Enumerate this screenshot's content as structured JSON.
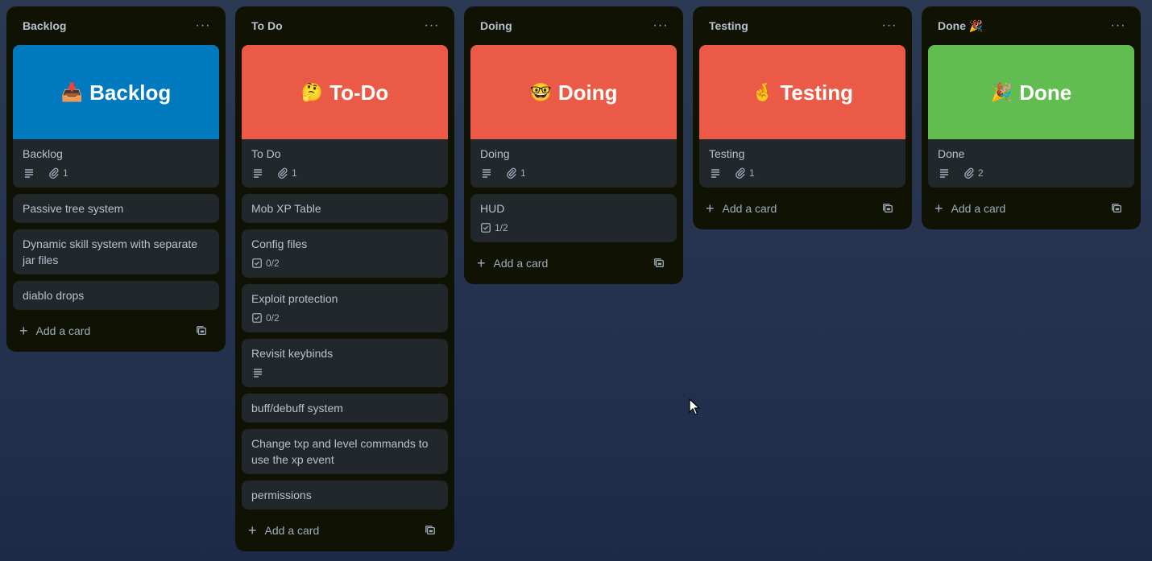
{
  "colors": {
    "blue": "#0079bf",
    "red": "#eb5a46",
    "green": "#61bd4f"
  },
  "lists": [
    {
      "title": "Backlog",
      "cover_card": {
        "cover_text": "Backlog",
        "cover_emoji": "📥",
        "title": "Backlog",
        "attachments": "1"
      },
      "cards": [
        {
          "title": "Passive tree system"
        },
        {
          "title": "Dynamic skill system with separate jar files"
        },
        {
          "title": "diablo drops"
        }
      ]
    },
    {
      "title": "To Do",
      "cover_card": {
        "cover_text": "To-Do",
        "cover_emoji": "🤔",
        "title": "To Do",
        "attachments": "1"
      },
      "cards": [
        {
          "title": "Mob XP Table"
        },
        {
          "title": "Config files",
          "checklist": "0/2"
        },
        {
          "title": "Exploit protection",
          "checklist": "0/2"
        },
        {
          "title": "Revisit keybinds"
        },
        {
          "title": "buff/debuff system"
        },
        {
          "title": "Change txp and level commands to use the xp event"
        },
        {
          "title": "permissions"
        }
      ]
    },
    {
      "title": "Doing",
      "cover_card": {
        "cover_text": "Doing",
        "cover_emoji": "🤓",
        "title": "Doing",
        "attachments": "1"
      },
      "cards": [
        {
          "title": "HUD",
          "checklist": "1/2"
        }
      ]
    },
    {
      "title": "Testing",
      "cover_card": {
        "cover_text": "Testing",
        "cover_emoji": "🤞",
        "title": "Testing",
        "attachments": "1"
      },
      "cards": []
    },
    {
      "title": "Done 🎉",
      "cover_card": {
        "cover_text": "Done",
        "cover_emoji": "🎉",
        "title": "Done",
        "attachments": "2"
      },
      "cards": []
    }
  ],
  "add_card_label": "Add a card",
  "list_menu_label": "···"
}
